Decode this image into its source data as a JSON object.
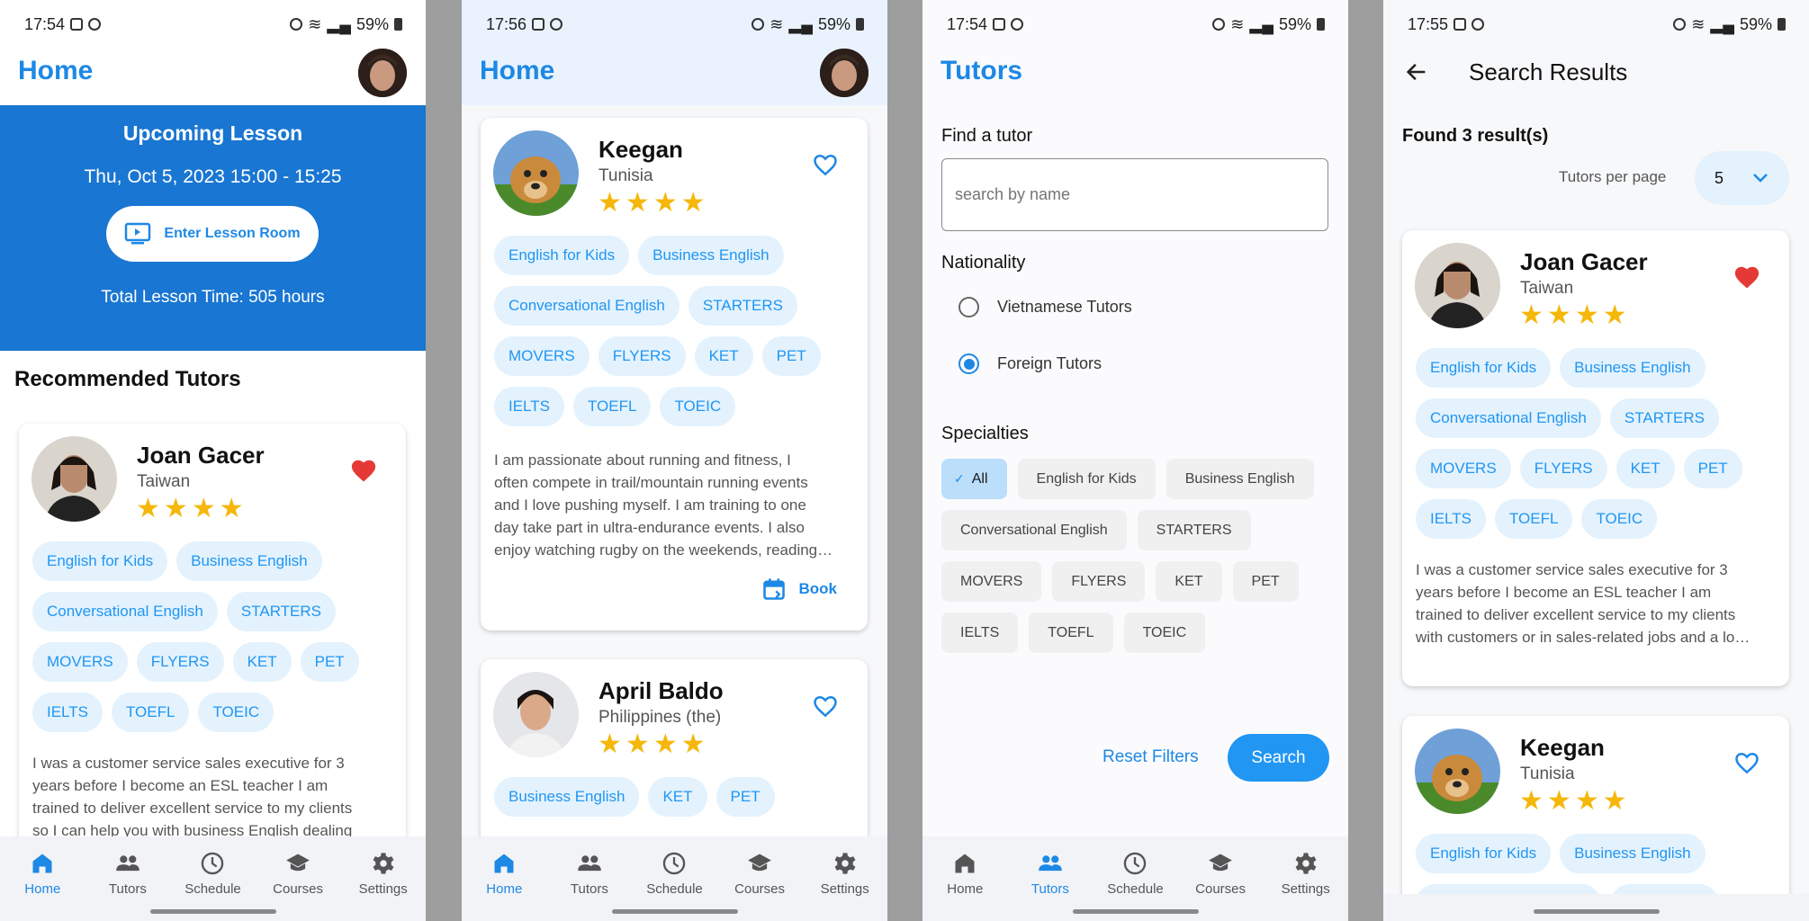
{
  "status": {
    "p1_time": "17:54",
    "p2_time": "17:56",
    "p3_time": "17:54",
    "p4_time": "17:55",
    "battery": "59%"
  },
  "nav": {
    "items": [
      "Home",
      "Tutors",
      "Schedule",
      "Courses",
      "Settings"
    ]
  },
  "home": {
    "title": "Home",
    "upcoming_title": "Upcoming Lesson",
    "upcoming_time": "Thu, Oct 5, 2023 15:00 - 15:25",
    "enter_button": "Enter Lesson Room",
    "total_time": "Total Lesson Time: 505 hours",
    "recommended_title": "Recommended Tutors"
  },
  "tutors": {
    "joan": {
      "name": "Joan Gacer",
      "country": "Taiwan",
      "rating": 4,
      "favorite": true,
      "specialties": [
        "English for Kids",
        "Business English",
        "Conversational English",
        "STARTERS",
        "MOVERS",
        "FLYERS",
        "KET",
        "PET",
        "IELTS",
        "TOEFL",
        "TOEIC"
      ],
      "bio_lines": [
        "I was a customer service sales executive for 3",
        "years before I become an ESL teacher I am",
        "trained to deliver excellent service to my clients",
        "so I can help you with business English dealing"
      ],
      "bio_lines_p4": [
        "I was a customer service sales executive for 3",
        "years before I become an ESL teacher I am",
        "trained to deliver excellent service to my clients",
        "with customers or in sales-related jobs and a lo…"
      ]
    },
    "keegan": {
      "name": "Keegan",
      "country": "Tunisia",
      "rating": 4,
      "favorite": false,
      "specialties": [
        "English for Kids",
        "Business English",
        "Conversational English",
        "STARTERS",
        "MOVERS",
        "FLYERS",
        "KET",
        "PET",
        "IELTS",
        "TOEFL",
        "TOEIC"
      ],
      "bio_lines": [
        "I am passionate about running and fitness, I",
        "often compete in trail/mountain running events",
        "and I love pushing myself. I am training to one",
        "day take part in ultra-endurance events. I also",
        "enjoy watching rugby on the weekends, reading…"
      ],
      "book_label": "Book"
    },
    "april": {
      "name": "April Baldo",
      "country": "Philippines (the)",
      "rating": 4,
      "favorite": false,
      "specialties": [
        "Business English",
        "KET",
        "PET"
      ]
    }
  },
  "search": {
    "title": "Tutors",
    "find_label": "Find a tutor",
    "placeholder": "search by name",
    "nationality_label": "Nationality",
    "option_vn": "Vietnamese Tutors",
    "option_foreign": "Foreign Tutors",
    "selected_option": "Foreign Tutors",
    "specialties_label": "Specialties",
    "specialty_chips": [
      "All",
      "English for Kids",
      "Business English",
      "Conversational English",
      "STARTERS",
      "MOVERS",
      "FLYERS",
      "KET",
      "PET",
      "IELTS",
      "TOEFL",
      "TOEIC"
    ],
    "selected_chip": "All",
    "reset_label": "Reset Filters",
    "search_label": "Search"
  },
  "results": {
    "title": "Search Results",
    "found": "Found 3 result(s)",
    "per_page_label": "Tutors per page",
    "per_page_value": "5"
  },
  "colors": {
    "accent": "#1e88e5",
    "banner": "#1976d2",
    "chip_bg": "#e3f2fd",
    "star": "#f5b70a",
    "heart_fav": "#e53935"
  }
}
